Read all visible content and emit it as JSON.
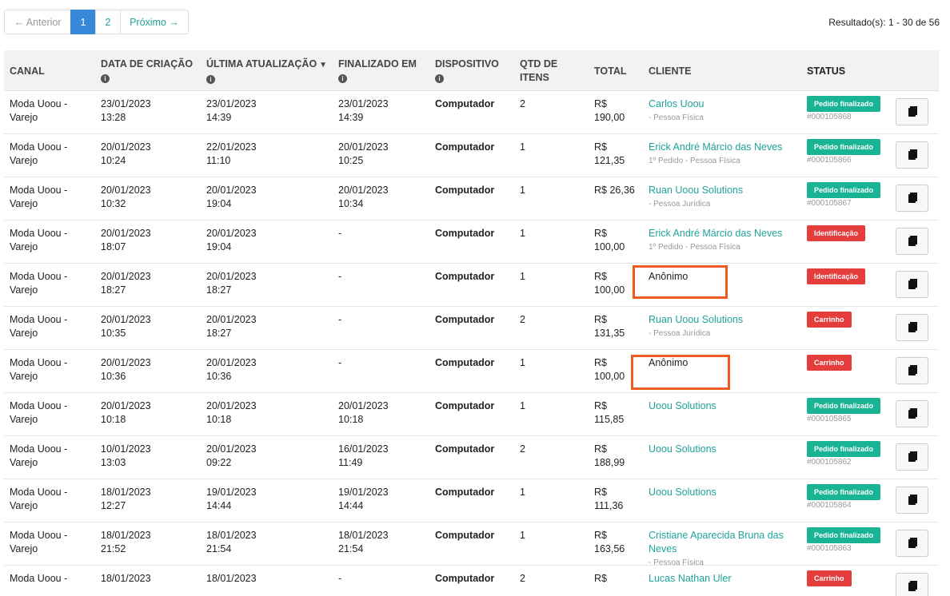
{
  "pagination": {
    "prev_label": "← Anterior",
    "pages": [
      "1",
      "2"
    ],
    "active_page": "1",
    "next_label": "Próximo →",
    "results_text": "Resultado(s): 1 - 30 de 56"
  },
  "columns": {
    "canal": "CANAL",
    "data_criacao": "DATA DE CRIAÇÃO",
    "ultima_atualizacao": "ÚLTIMA ATUALIZAÇÃO",
    "finalizado_em": "FINALIZADO EM",
    "dispositivo": "DISPOSITIVO",
    "qtd_itens": "QTD DE ITENS",
    "total": "TOTAL",
    "cliente": "CLIENTE",
    "status": "STATUS"
  },
  "rows": [
    {
      "canal": [
        "Moda Uoou -",
        "Varejo"
      ],
      "data": [
        "23/01/2023",
        "13:28"
      ],
      "ult": [
        "23/01/2023",
        "14:39"
      ],
      "fin": [
        "23/01/2023",
        "14:39"
      ],
      "disp": "Computador",
      "qtd": "2",
      "total": [
        "R$",
        "190,00"
      ],
      "cliente": "Carlos Uoou",
      "cliente_sub": "- Pessoa Física",
      "status": "Pedido finalizado",
      "status_color": "green",
      "order": "#000105868"
    },
    {
      "canal": [
        "Moda Uoou -",
        "Varejo"
      ],
      "data": [
        "20/01/2023",
        "10:24"
      ],
      "ult": [
        "22/01/2023",
        "11:10"
      ],
      "fin": [
        "20/01/2023",
        "10:25"
      ],
      "disp": "Computador",
      "qtd": "1",
      "total": [
        "R$",
        "121,35"
      ],
      "cliente": "Erick André Márcio das Neves",
      "cliente_sub": "1º Pedido - Pessoa Física",
      "status": "Pedido finalizado",
      "status_color": "green",
      "order": "#000105866"
    },
    {
      "canal": [
        "Moda Uoou -",
        "Varejo"
      ],
      "data": [
        "20/01/2023",
        "10:32"
      ],
      "ult": [
        "20/01/2023",
        "19:04"
      ],
      "fin": [
        "20/01/2023",
        "10:34"
      ],
      "disp": "Computador",
      "qtd": "1",
      "total": [
        "R$ 26,36",
        ""
      ],
      "cliente": "Ruan Uoou Solutions",
      "cliente_sub": "- Pessoa Jurídica",
      "status": "Pedido finalizado",
      "status_color": "green",
      "order": "#000105867"
    },
    {
      "canal": [
        "Moda Uoou -",
        "Varejo"
      ],
      "data": [
        "20/01/2023",
        "18:07"
      ],
      "ult": [
        "20/01/2023",
        "19:04"
      ],
      "fin": [
        "-",
        ""
      ],
      "disp": "Computador",
      "qtd": "1",
      "total": [
        "R$",
        "100,00"
      ],
      "cliente": "Erick André Márcio das Neves",
      "cliente_sub": "1º Pedido - Pessoa Física",
      "status": "Identificação",
      "status_color": "red",
      "order": ""
    },
    {
      "canal": [
        "Moda Uoou -",
        "Varejo"
      ],
      "data": [
        "20/01/2023",
        "18:27"
      ],
      "ult": [
        "20/01/2023",
        "18:27"
      ],
      "fin": [
        "-",
        ""
      ],
      "disp": "Computador",
      "qtd": "1",
      "total": [
        "R$",
        "100,00"
      ],
      "cliente": "Anônimo",
      "cliente_sub": "",
      "status": "Identificação",
      "status_color": "red",
      "order": ""
    },
    {
      "canal": [
        "Moda Uoou -",
        "Varejo"
      ],
      "data": [
        "20/01/2023",
        "10:35"
      ],
      "ult": [
        "20/01/2023",
        "18:27"
      ],
      "fin": [
        "-",
        ""
      ],
      "disp": "Computador",
      "qtd": "2",
      "total": [
        "R$",
        "131,35"
      ],
      "cliente": "Ruan Uoou Solutions",
      "cliente_sub": "- Pessoa Jurídica",
      "status": "Carrinho",
      "status_color": "red",
      "order": ""
    },
    {
      "canal": [
        "Moda Uoou -",
        "Varejo"
      ],
      "data": [
        "20/01/2023",
        "10:36"
      ],
      "ult": [
        "20/01/2023",
        "10:36"
      ],
      "fin": [
        "-",
        ""
      ],
      "disp": "Computador",
      "qtd": "1",
      "total": [
        "R$",
        "100,00"
      ],
      "cliente": "Anônimo",
      "cliente_sub": "",
      "status": "Carrinho",
      "status_color": "red",
      "order": ""
    },
    {
      "canal": [
        "Moda Uoou -",
        "Varejo"
      ],
      "data": [
        "20/01/2023",
        "10:18"
      ],
      "ult": [
        "20/01/2023",
        "10:18"
      ],
      "fin": [
        "20/01/2023",
        "10:18"
      ],
      "disp": "Computador",
      "qtd": "1",
      "total": [
        "R$",
        "115,85"
      ],
      "cliente": "Uoou Solutions",
      "cliente_sub": "",
      "status": "Pedido finalizado",
      "status_color": "green",
      "order": "#000105865"
    },
    {
      "canal": [
        "Moda Uoou -",
        "Varejo"
      ],
      "data": [
        "10/01/2023",
        "13:03"
      ],
      "ult": [
        "20/01/2023",
        "09:22"
      ],
      "fin": [
        "16/01/2023",
        "11:49"
      ],
      "disp": "Computador",
      "qtd": "2",
      "total": [
        "R$",
        "188,99"
      ],
      "cliente": "Uoou Solutions",
      "cliente_sub": "",
      "status": "Pedido finalizado",
      "status_color": "green",
      "order": "#000105862"
    },
    {
      "canal": [
        "Moda Uoou -",
        "Varejo"
      ],
      "data": [
        "18/01/2023",
        "12:27"
      ],
      "ult": [
        "19/01/2023",
        "14:44"
      ],
      "fin": [
        "19/01/2023",
        "14:44"
      ],
      "disp": "Computador",
      "qtd": "1",
      "total": [
        "R$",
        "111,36"
      ],
      "cliente": "Uoou Solutions",
      "cliente_sub": "",
      "status": "Pedido finalizado",
      "status_color": "green",
      "order": "#000105864"
    },
    {
      "canal": [
        "Moda Uoou -",
        "Varejo"
      ],
      "data": [
        "18/01/2023",
        "21:52"
      ],
      "ult": [
        "18/01/2023",
        "21:54"
      ],
      "fin": [
        "18/01/2023",
        "21:54"
      ],
      "disp": "Computador",
      "qtd": "1",
      "total": [
        "R$",
        "163,56"
      ],
      "cliente": "Cristiane Aparecida Bruna das Neves",
      "cliente_sub": "- Pessoa Física",
      "status": "Pedido finalizado",
      "status_color": "green",
      "order": "#000105863"
    },
    {
      "canal": [
        "Moda Uoou -",
        ""
      ],
      "data": [
        "18/01/2023",
        ""
      ],
      "ult": [
        "18/01/2023",
        ""
      ],
      "fin": [
        "-",
        ""
      ],
      "disp": "Computador",
      "qtd": "2",
      "total": [
        "R$",
        ""
      ],
      "cliente": "Lucas Nathan Uler",
      "cliente_sub": "",
      "status": "Carrinho",
      "status_color": "red",
      "order": ""
    }
  ],
  "icons": {
    "info": "info-icon",
    "chevron": "chevron-down-icon",
    "action": "document-icon"
  },
  "colors": {
    "link": "#1fa39a",
    "active_page": "#3788d8",
    "status_green": "#18b493",
    "status_red": "#e53c3c",
    "highlight": "#ef5a1f"
  }
}
